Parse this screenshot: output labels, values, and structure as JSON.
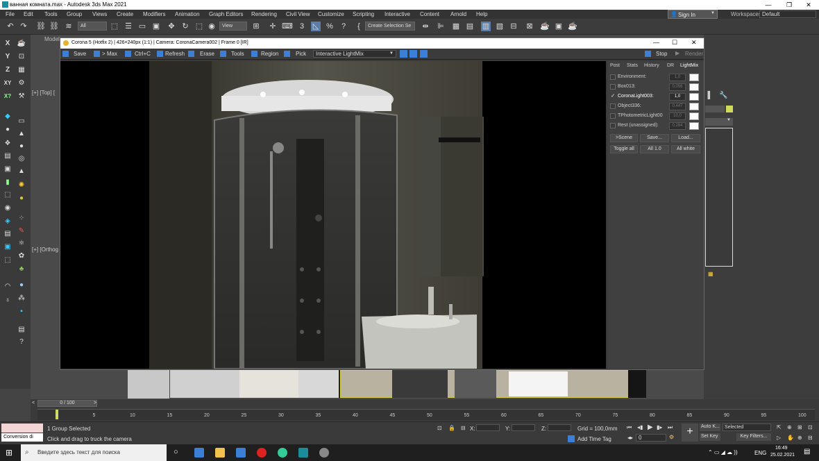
{
  "app": {
    "title": "ванная комната.max - Autodesk 3ds Max 2021"
  },
  "menu": [
    "File",
    "Edit",
    "Tools",
    "Group",
    "Views",
    "Create",
    "Modifiers",
    "Animation",
    "Graph Editors",
    "Rendering",
    "Civil View",
    "Customize",
    "Scripting",
    "Interactive",
    "Content",
    "Arnold",
    "Help"
  ],
  "signin": "Sign In",
  "workspaces_label": "Workspaces:",
  "workspaces_value": "Default",
  "toolbar": {
    "filter": "All",
    "view": "View",
    "selection_set": "Create Selection Se"
  },
  "viewports": {
    "model_tab": "Model",
    "top_label": "[+] [Top] [",
    "ortho_label": "[+] [Orthog"
  },
  "vfb": {
    "title": "Corona 5 (Hotfix 2) | 426×240px (1:1) | Camera: CoronaCamera002 | Frame 0 [IR]",
    "save": "Save",
    "max": "> Max",
    "ctrlc": "Ctrl+C",
    "refresh": "Refresh",
    "erase": "Erase",
    "tools": "Tools",
    "region": "Region",
    "pick": "Pick",
    "lightmix_select": "Interactive LightMix",
    "stop": "Stop",
    "render": "Render",
    "tabs": [
      "Post",
      "Stats",
      "History",
      "DR",
      "LightMix"
    ],
    "lights": [
      {
        "name": "Environment:",
        "checked": false,
        "value": "1,0"
      },
      {
        "name": "Box013:",
        "checked": false,
        "value": "0,056"
      },
      {
        "name": "CoronaLight003:",
        "checked": true,
        "value": "1,0"
      },
      {
        "name": "Object336:",
        "checked": false,
        "value": "0,447"
      },
      {
        "name": "TPhotometricLight00",
        "checked": false,
        "value": "10,0"
      },
      {
        "name": "Rest (unassigned):",
        "checked": false,
        "value": "0,284"
      }
    ],
    "buttons1": [
      ">Scene",
      "Save...",
      "Load..."
    ],
    "buttons2": [
      "Toggle all",
      "All 1.0",
      "All white"
    ]
  },
  "timeline": {
    "frame": "0 / 100",
    "ticks": [
      "0",
      "5",
      "10",
      "15",
      "20",
      "25",
      "30",
      "35",
      "40",
      "45",
      "50",
      "55",
      "60",
      "65",
      "70",
      "75",
      "80",
      "85",
      "90",
      "95",
      "100"
    ]
  },
  "status": {
    "selected": "1 Group Selected",
    "hint": "Click and drag to truck the camera",
    "conversion": "Conversion di",
    "x_label": "X:",
    "y_label": "Y:",
    "z_label": "Z:",
    "grid": "Grid = 100,0mm",
    "add_time_tag": "Add Time Tag",
    "autokey": "Auto K...",
    "selected_dd": "Selected",
    "setkey": "Set Key",
    "keyfilters": "Key Filters...",
    "frame_input": "0"
  },
  "taskbar": {
    "search": "Введите здесь текст для поиска",
    "lang": "ENG",
    "time": "16:49",
    "date": "25.02.2021"
  }
}
